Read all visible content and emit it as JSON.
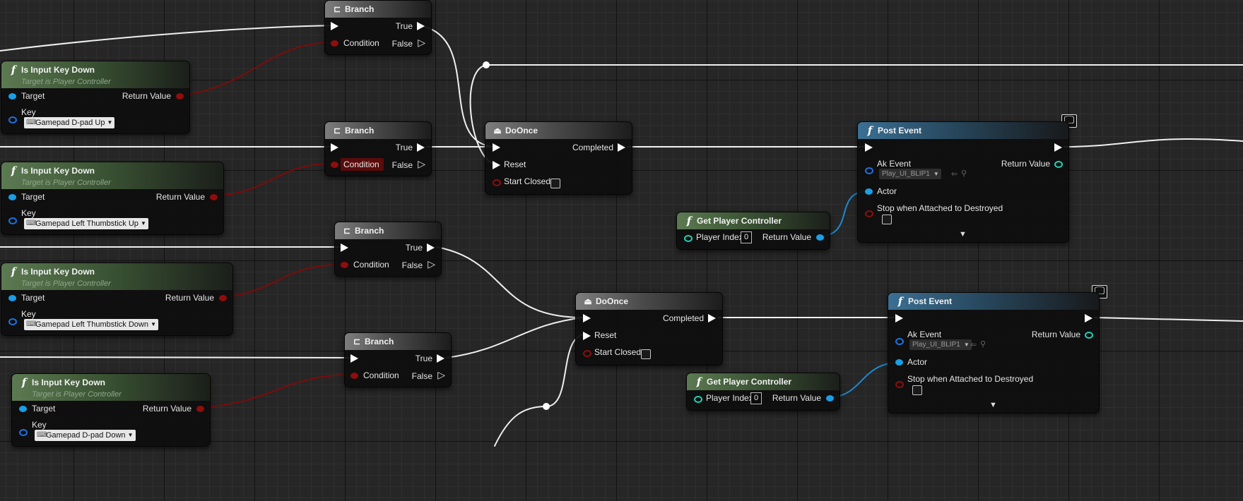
{
  "graph": {
    "branch_nodes": [
      {
        "title": "Branch",
        "in_pins": [
          "",
          "Condition"
        ],
        "out_true": "True",
        "out_false": "False"
      },
      {
        "title": "Branch",
        "in_pins": [
          "",
          "Condition"
        ],
        "out_true": "True",
        "out_false": "False"
      },
      {
        "title": "Branch",
        "in_pins": [
          "",
          "Condition"
        ],
        "out_true": "True",
        "out_false": "False"
      },
      {
        "title": "Branch",
        "in_pins": [
          "",
          "Condition"
        ],
        "out_true": "True",
        "out_false": "False"
      }
    ],
    "input_nodes": [
      {
        "title": "Is Input Key Down",
        "subtitle": "Target is Player Controller",
        "target": "Target",
        "return": "Return Value",
        "key_label": "Key",
        "key_value": "Gamepad D-pad Up"
      },
      {
        "title": "Is Input Key Down",
        "subtitle": "Target is Player Controller",
        "target": "Target",
        "return": "Return Value",
        "key_label": "Key",
        "key_value": "Gamepad Left Thumbstick Up"
      },
      {
        "title": "Is Input Key Down",
        "subtitle": "Target is Player Controller",
        "target": "Target",
        "return": "Return Value",
        "key_label": "Key",
        "key_value": "Gamepad Left Thumbstick Down"
      },
      {
        "title": "Is Input Key Down",
        "subtitle": "Target is Player Controller",
        "target": "Target",
        "return": "Return Value",
        "key_label": "Key",
        "key_value": "Gamepad D-pad Down"
      }
    ],
    "doonce_nodes": [
      {
        "title": "DoOnce",
        "completed": "Completed",
        "reset": "Reset",
        "start_closed": "Start Closed"
      },
      {
        "title": "DoOnce",
        "completed": "Completed",
        "reset": "Reset",
        "start_closed": "Start Closed"
      }
    ],
    "post_event_nodes": [
      {
        "title": "Post Event",
        "ak_event": "Ak Event",
        "ak_value": "Play_UI_BLIP1",
        "return": "Return Value",
        "actor": "Actor",
        "stop": "Stop when Attached to Destroyed"
      },
      {
        "title": "Post Event",
        "ak_event": "Ak Event",
        "ak_value": "Play_UI_BLIP1",
        "return": "Return Value",
        "actor": "Actor",
        "stop": "Stop when Attached to Destroyed"
      }
    ],
    "player_controller_nodes": [
      {
        "title": "Get Player Controller",
        "player_index": "Player Index",
        "index_value": "0",
        "return": "Return Value"
      },
      {
        "title": "Get Player Controller",
        "player_index": "Player Index",
        "index_value": "0",
        "return": "Return Value"
      }
    ],
    "pin_colors": {
      "exec": "#ffffff",
      "bool": "#8f0d0d",
      "object": "#1a9ee6",
      "int": "#1fd1b4"
    }
  }
}
